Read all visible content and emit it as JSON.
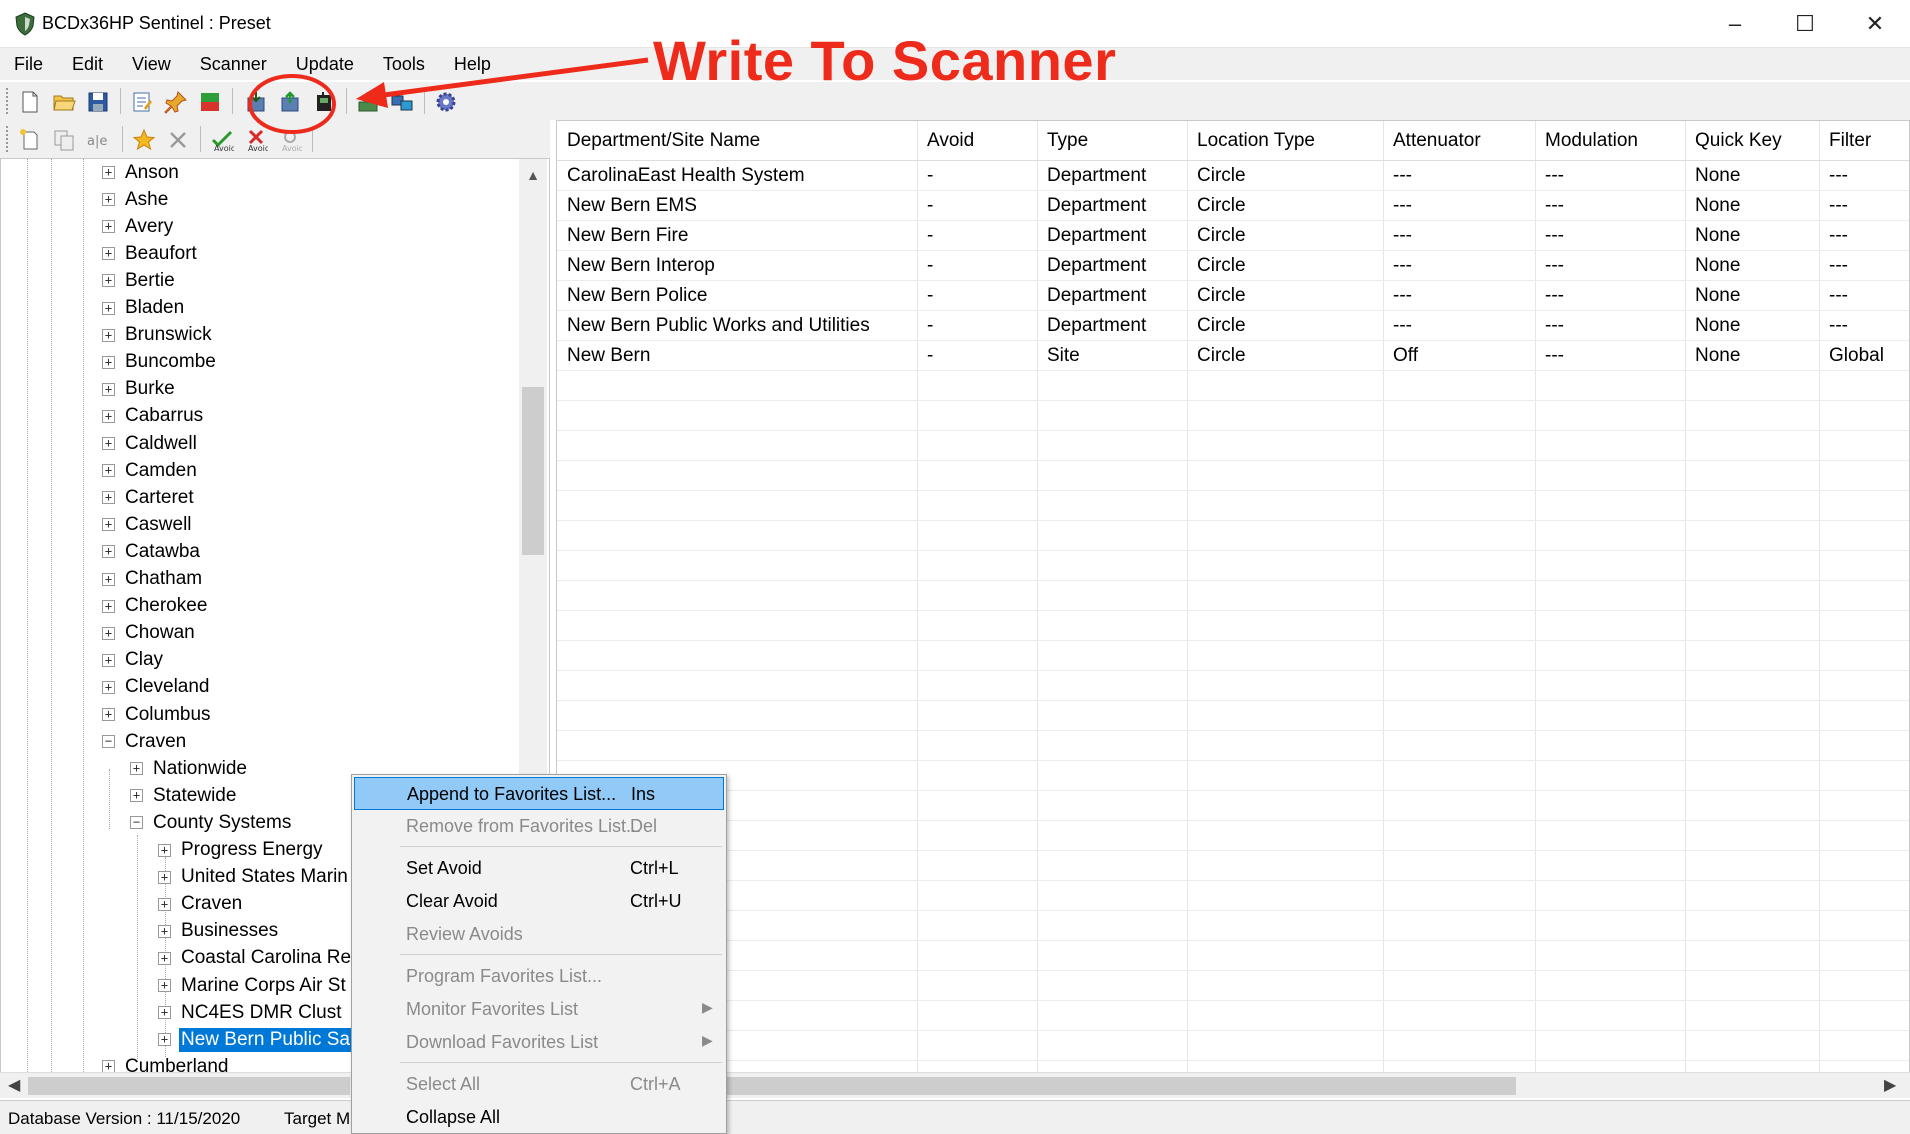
{
  "window": {
    "title": "BCDx36HP Sentinel : Preset",
    "controls": [
      "–",
      "☐",
      "✕"
    ]
  },
  "menu": [
    "File",
    "Edit",
    "View",
    "Scanner",
    "Update",
    "Tools",
    "Help"
  ],
  "annotation": {
    "text": "Write To Scanner",
    "color": "#ee2a1b"
  },
  "tree": {
    "counties": [
      "Anson",
      "Ashe",
      "Avery",
      "Beaufort",
      "Bertie",
      "Bladen",
      "Brunswick",
      "Buncombe",
      "Burke",
      "Cabarrus",
      "Caldwell",
      "Camden",
      "Carteret",
      "Caswell",
      "Catawba",
      "Chatham",
      "Cherokee",
      "Chowan",
      "Clay",
      "Cleveland",
      "Columbus"
    ],
    "expanded": "Craven",
    "expanded_children": [
      "Nationwide",
      "Statewide"
    ],
    "county_systems_label": "County Systems",
    "county_systems": [
      "Progress Energy",
      "United States Marin",
      "Craven",
      "Businesses",
      "Coastal Carolina Re",
      "Marine Corps Air St",
      "NC4ES DMR Clust"
    ],
    "selected": "New Bern Public Sa",
    "after": "Cumberland"
  },
  "grid": {
    "columns": [
      "Department/Site Name",
      "Avoid",
      "Type",
      "Location Type",
      "Attenuator",
      "Modulation",
      "Quick Key",
      "Filter"
    ],
    "rows": [
      [
        "CarolinaEast Health System",
        "-",
        "Department",
        "Circle",
        "---",
        "---",
        "None",
        "---"
      ],
      [
        "New Bern EMS",
        "-",
        "Department",
        "Circle",
        "---",
        "---",
        "None",
        "---"
      ],
      [
        "New Bern Fire",
        "-",
        "Department",
        "Circle",
        "---",
        "---",
        "None",
        "---"
      ],
      [
        "New Bern Interop",
        "-",
        "Department",
        "Circle",
        "---",
        "---",
        "None",
        "---"
      ],
      [
        "New Bern Police",
        "-",
        "Department",
        "Circle",
        "---",
        "---",
        "None",
        "---"
      ],
      [
        "New Bern Public Works and Utilities",
        "-",
        "Department",
        "Circle",
        "---",
        "---",
        "None",
        "---"
      ],
      [
        "New Bern",
        "-",
        "Site",
        "Circle",
        "Off",
        "---",
        "None",
        "Global"
      ]
    ]
  },
  "context_menu": {
    "items": [
      {
        "label": "Append to Favorites List...",
        "shortcut": "Ins",
        "disabled": false,
        "highlight": true
      },
      {
        "label": "Remove from Favorites List...",
        "shortcut": "Del",
        "disabled": true
      },
      {
        "label": "Set Avoid",
        "shortcut": "Ctrl+L",
        "disabled": false
      },
      {
        "label": "Clear Avoid",
        "shortcut": "Ctrl+U",
        "disabled": false
      },
      {
        "label": "Review Avoids",
        "shortcut": "",
        "disabled": true
      },
      {
        "label": "Program Favorites List...",
        "shortcut": "",
        "disabled": true
      },
      {
        "label": "Monitor Favorites List",
        "shortcut": "",
        "disabled": true,
        "submenu": true
      },
      {
        "label": "Download Favorites List",
        "shortcut": "",
        "disabled": true,
        "submenu": true
      },
      {
        "label": "Select All",
        "shortcut": "Ctrl+A",
        "disabled": true
      },
      {
        "label": "Collapse All",
        "shortcut": "",
        "disabled": false
      }
    ]
  },
  "status": {
    "database": "Database Version : 11/15/2020",
    "target": "Target M"
  }
}
